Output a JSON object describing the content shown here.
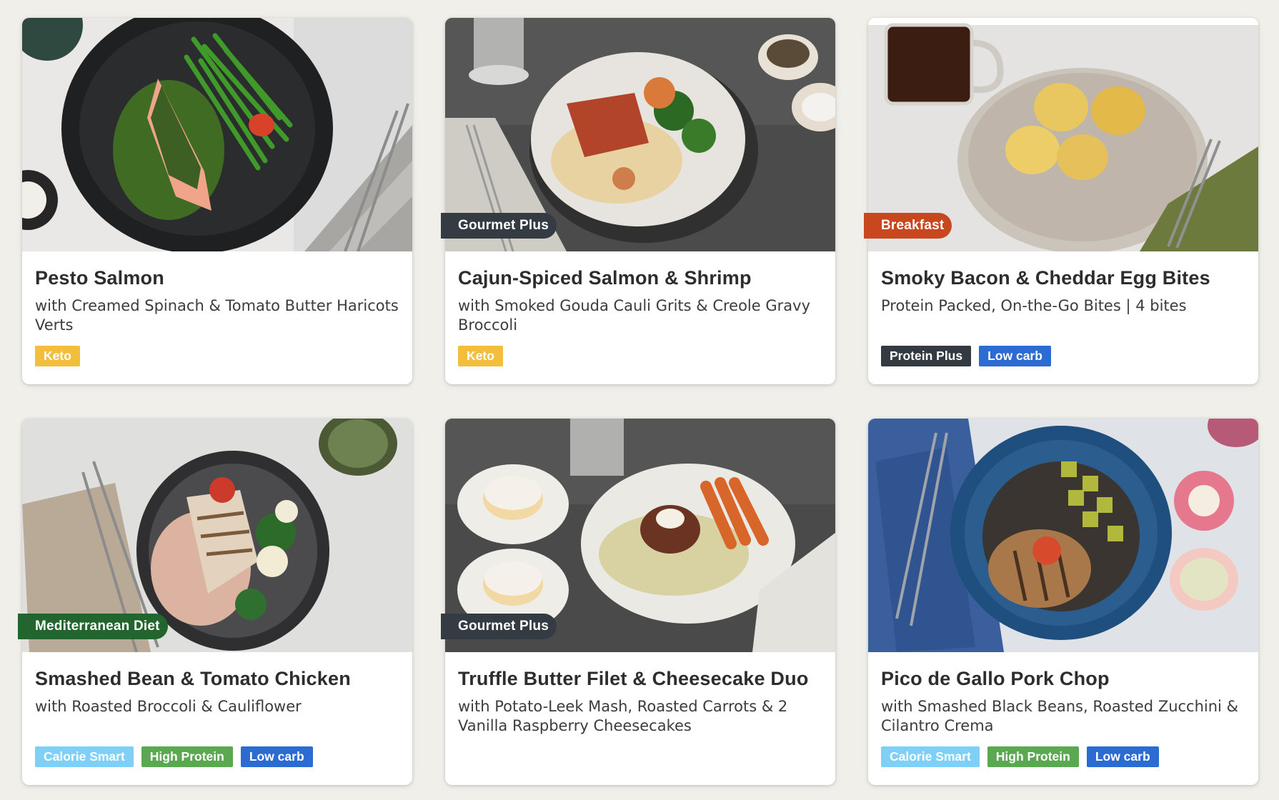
{
  "tag_colors": {
    "Keto": "#f3be3c",
    "Protein Plus": "#343a41",
    "Low carb": "#2c6bd1",
    "Calorie Smart": "#7fd0f6",
    "High Protein": "#5ba752"
  },
  "badge_colors": {
    "Gourmet Plus": "#353b42",
    "Breakfast": "#c8471f",
    "Mediterranean Diet": "#22652e"
  },
  "meals": [
    {
      "title": "Pesto Salmon",
      "subtitle": "with Creamed Spinach & Tomato Butter Haricots Verts",
      "badge": "",
      "tags": [
        "Keto"
      ],
      "photo_icon": "salmon-plate-photo"
    },
    {
      "title": "Cajun-Spiced Salmon & Shrimp",
      "subtitle": "with Smoked Gouda Cauli Grits & Creole Gravy Broccoli",
      "badge": "Gourmet Plus",
      "tags": [
        "Keto"
      ],
      "photo_icon": "salmon-shrimp-plate-photo"
    },
    {
      "title": "Smoky Bacon & Cheddar Egg Bites",
      "subtitle": "Protein Packed, On-the-Go Bites | 4 bites",
      "badge": "Breakfast",
      "tags": [
        "Protein Plus",
        "Low carb"
      ],
      "photo_icon": "egg-bites-plate-photo"
    },
    {
      "title": "Smashed Bean & Tomato Chicken",
      "subtitle": "with Roasted Broccoli & Cauliflower",
      "badge": "Mediterranean Diet",
      "tags": [
        "Calorie Smart",
        "High Protein",
        "Low carb"
      ],
      "photo_icon": "chicken-plate-photo"
    },
    {
      "title": "Truffle Butter Filet & Cheesecake Duo",
      "subtitle": "with Potato-Leek Mash, Roasted Carrots & 2 Vanilla Raspberry Cheesecakes",
      "badge": "Gourmet Plus",
      "tags": [],
      "photo_icon": "filet-cheesecake-plate-photo"
    },
    {
      "title": "Pico de Gallo Pork Chop",
      "subtitle": "with Smashed Black Beans, Roasted Zucchini & Cilantro Crema",
      "badge": "",
      "tags": [
        "Calorie Smart",
        "High Protein",
        "Low carb"
      ],
      "photo_icon": "pork-chop-plate-photo"
    }
  ]
}
